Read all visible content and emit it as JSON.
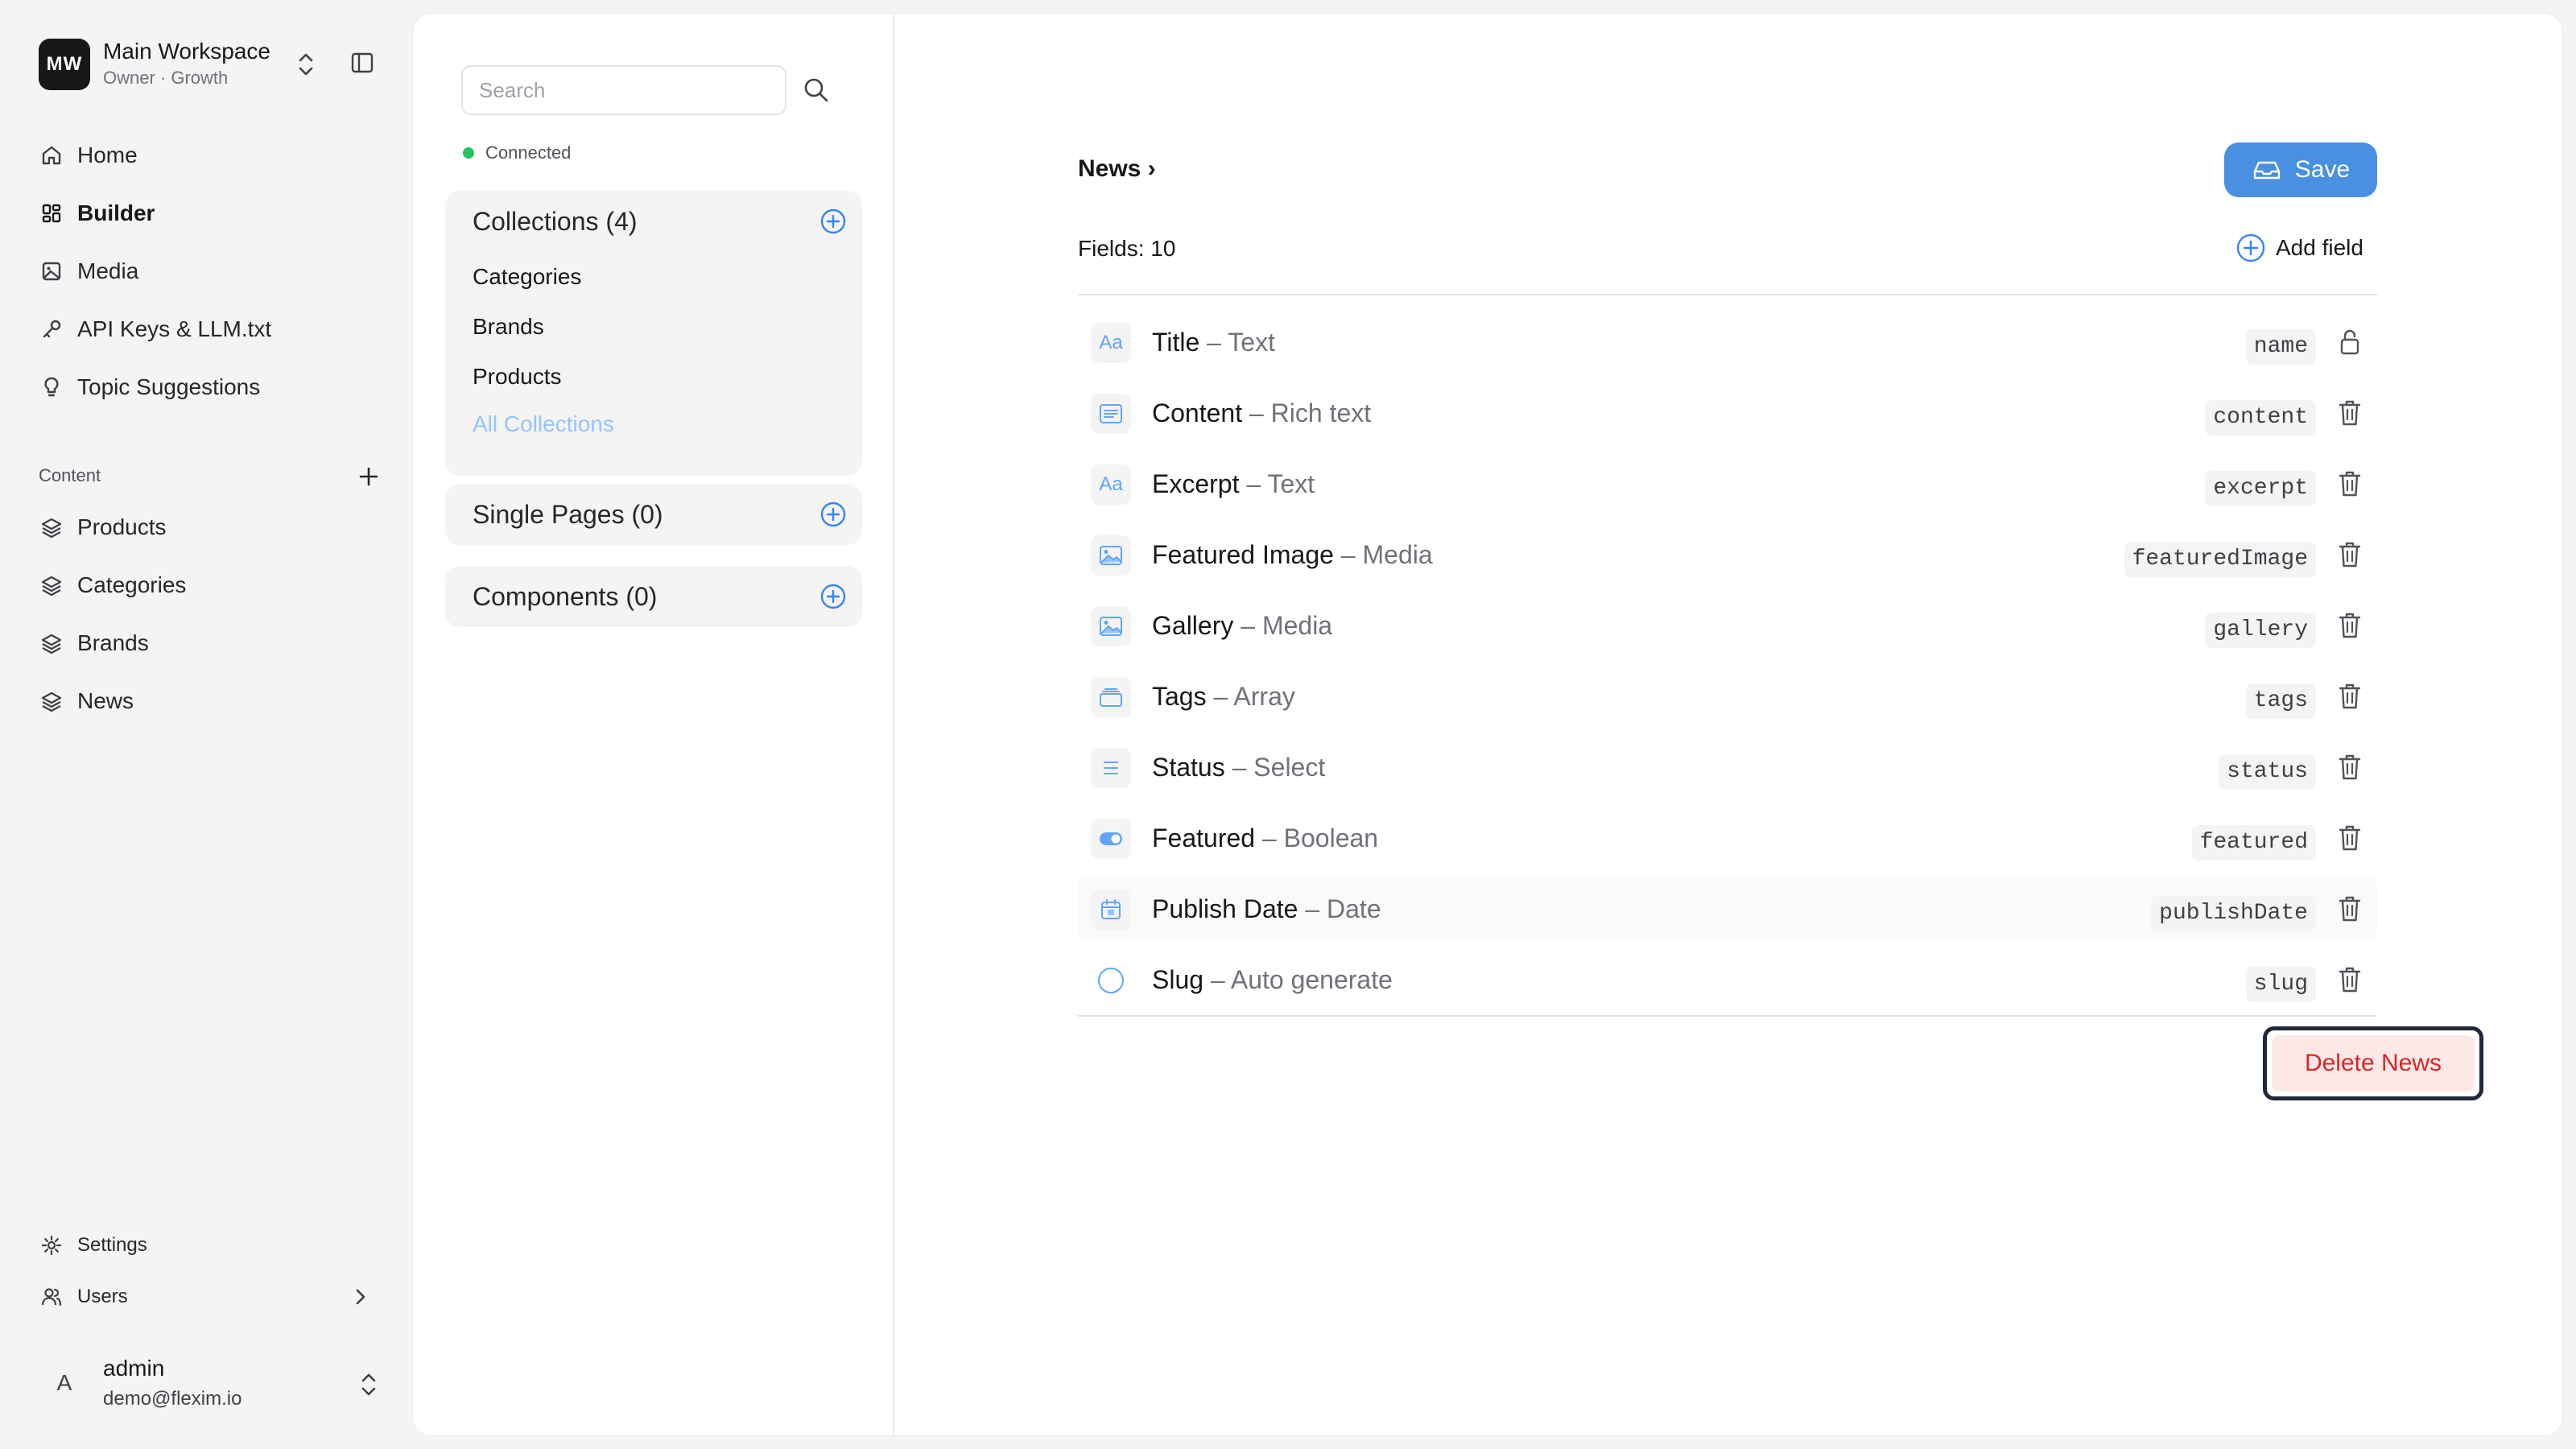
{
  "workspace": {
    "initials": "MW",
    "name": "Main Workspace",
    "subtitle": "Owner · Growth"
  },
  "nav": [
    {
      "label": "Home",
      "icon": "home-icon"
    },
    {
      "label": "Builder",
      "icon": "layout-grid-icon",
      "active": true
    },
    {
      "label": "Media",
      "icon": "image-icon"
    },
    {
      "label": "API Keys & LLM.txt",
      "icon": "key-icon"
    },
    {
      "label": "Topic Suggestions",
      "icon": "lightbulb-icon"
    }
  ],
  "content_section": {
    "title": "Content",
    "items": [
      {
        "label": "Products",
        "icon": "layers-icon"
      },
      {
        "label": "Categories",
        "icon": "layers-icon"
      },
      {
        "label": "Brands",
        "icon": "layers-icon"
      },
      {
        "label": "News",
        "icon": "layers-icon"
      }
    ]
  },
  "bottom_nav": {
    "settings": "Settings",
    "users": "Users"
  },
  "user": {
    "initial": "A",
    "name": "admin",
    "email": "demo@flexim.io"
  },
  "middle": {
    "search_placeholder": "Search",
    "status": "Connected",
    "collections": {
      "title": "Collections (4)",
      "items": [
        "Categories",
        "Brands",
        "Products"
      ],
      "all_label": "All Collections"
    },
    "single_pages": {
      "title": "Single Pages (0)"
    },
    "components": {
      "title": "Components (0)"
    }
  },
  "editor": {
    "breadcrumb": "News ›",
    "save_label": "Save",
    "fields_count": "Fields: 10",
    "add_field_label": "Add field",
    "fields": [
      {
        "name": "Title",
        "type": "– Text",
        "key": "name",
        "icon": "text-icon",
        "glyph": "Aa",
        "action": "lock-icon"
      },
      {
        "name": "Content",
        "type": "– Rich text",
        "key": "content",
        "icon": "rich-text-icon",
        "glyph": "",
        "action": "trash-icon"
      },
      {
        "name": "Excerpt",
        "type": "– Text",
        "key": "excerpt",
        "icon": "text-icon",
        "glyph": "Aa",
        "action": "trash-icon"
      },
      {
        "name": "Featured Image",
        "type": "– Media",
        "key": "featuredImage",
        "icon": "media-icon",
        "glyph": "",
        "action": "trash-icon"
      },
      {
        "name": "Gallery",
        "type": "– Media",
        "key": "gallery",
        "icon": "media-icon",
        "glyph": "",
        "action": "trash-icon"
      },
      {
        "name": "Tags",
        "type": "– Array",
        "key": "tags",
        "icon": "array-icon",
        "glyph": "",
        "action": "trash-icon"
      },
      {
        "name": "Status",
        "type": "– Select",
        "key": "status",
        "icon": "select-icon",
        "glyph": "",
        "action": "trash-icon"
      },
      {
        "name": "Featured",
        "type": "– Boolean",
        "key": "featured",
        "icon": "toggle-icon",
        "glyph": "",
        "action": "trash-icon"
      },
      {
        "name": "Publish Date",
        "type": "– Date",
        "key": "publishDate",
        "icon": "calendar-icon",
        "glyph": "",
        "action": "trash-icon"
      },
      {
        "name": "Slug",
        "type": "– Auto generate",
        "key": "slug",
        "icon": "auto-generate-icon",
        "glyph": "",
        "action": "trash-icon"
      }
    ],
    "delete_label": "Delete News"
  },
  "colors": {
    "accent": "#4a90e2",
    "danger": "#dc2626",
    "danger_bg": "#fde8e8",
    "connected": "#22c55e"
  }
}
